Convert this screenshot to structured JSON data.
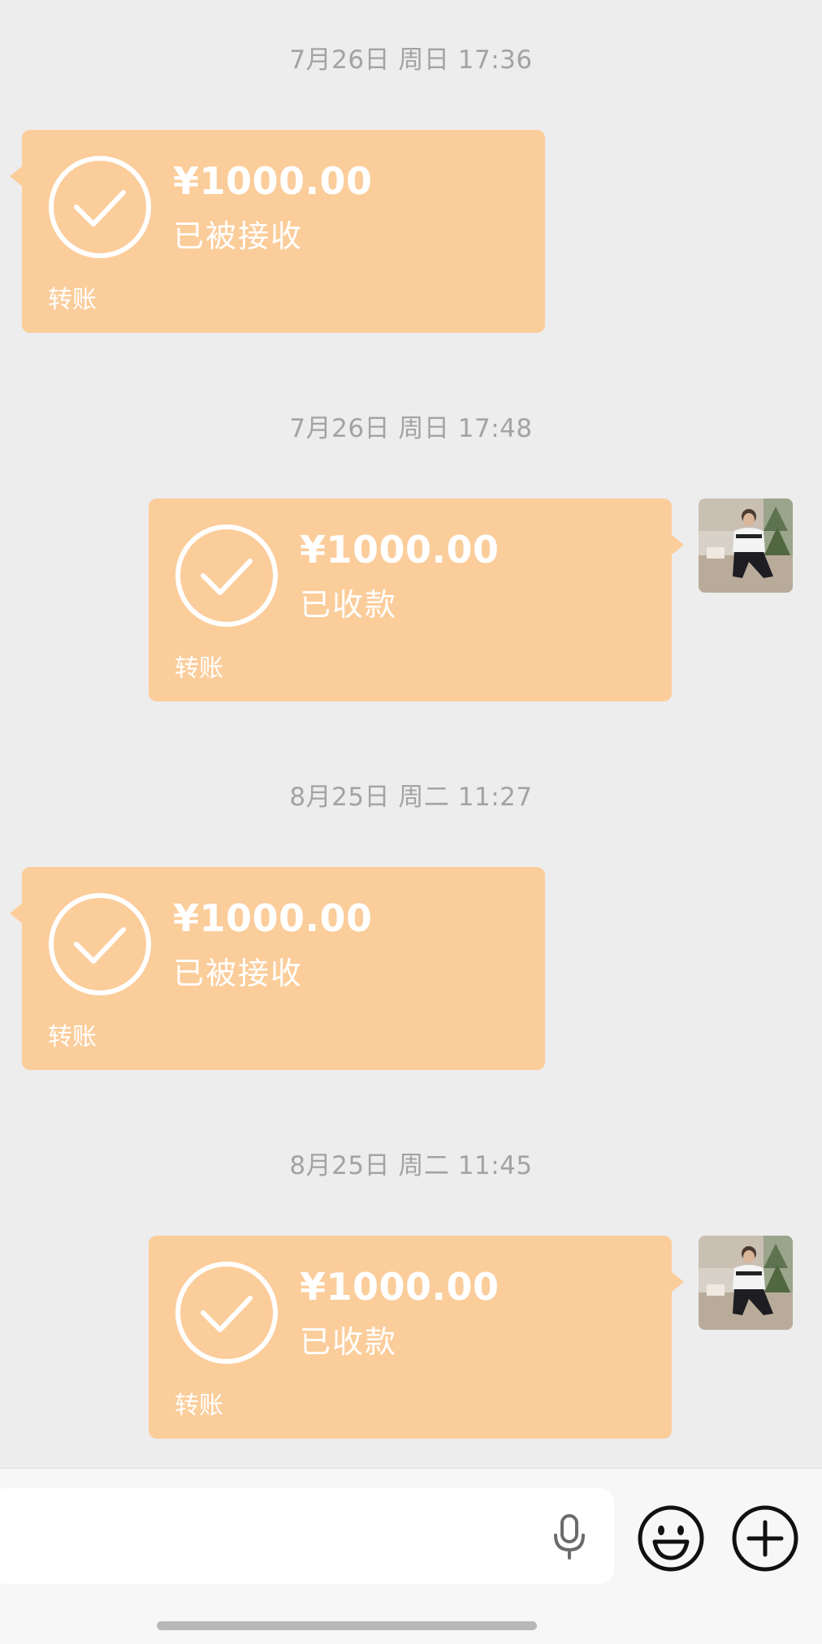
{
  "messages": [
    {
      "timestamp": "7月26日 周日 17:36",
      "amount": "¥1000.00",
      "status": "已被接收",
      "label": "转账",
      "side": "left"
    },
    {
      "timestamp": "7月26日 周日 17:48",
      "amount": "¥1000.00",
      "status": "已收款",
      "label": "转账",
      "side": "right"
    },
    {
      "timestamp": "8月25日 周二 11:27",
      "amount": "¥1000.00",
      "status": "已被接收",
      "label": "转账",
      "side": "left"
    },
    {
      "timestamp": "8月25日 周二 11:45",
      "amount": "¥1000.00",
      "status": "已收款",
      "label": "转账",
      "side": "right"
    }
  ],
  "colors": {
    "background": "#ededed",
    "bubble": "#fbcd9b",
    "bubble_text": "#ffffff",
    "timestamp_text": "#a3a3a3",
    "input_bar": "#f7f7f7"
  },
  "input_bar": {
    "icons": [
      "microphone-icon",
      "emoji-icon",
      "plus-icon"
    ]
  }
}
